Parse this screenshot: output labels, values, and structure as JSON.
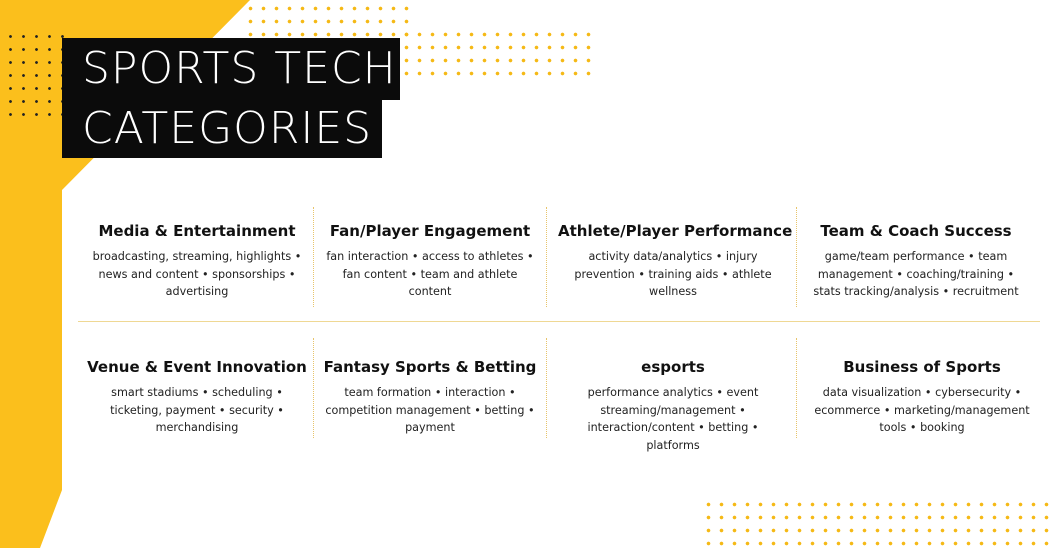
{
  "title": {
    "line1": "SPORTS TECH",
    "line2": "CATEGORIES"
  },
  "colors": {
    "accent": "#fbbf1c",
    "title_bg": "#0b0b0b",
    "divider": "#efd894"
  },
  "categories": [
    {
      "name": "Media & Entertainment",
      "text": "broadcasting, streaming, highlights • news and content • sponsorships • advertising"
    },
    {
      "name": "Fan/Player Engagement",
      "text": "fan interaction • access to athletes • fan content • team and athlete content"
    },
    {
      "name": "Athlete/Player Performance",
      "text": "activity data/analytics • injury prevention • training aids • athlete wellness"
    },
    {
      "name": "Team & Coach Success",
      "text": "game/team performance • team management • coaching/training • stats tracking/analysis • recruitment"
    },
    {
      "name": "Venue & Event Innovation",
      "text": "smart stadiums • scheduling • ticketing, payment • security • merchandising"
    },
    {
      "name": "Fantasy Sports & Betting",
      "text": "team formation • interaction • competition management • betting • payment"
    },
    {
      "name": "esports",
      "text": "performance analytics • event streaming/management • interaction/content • betting • platforms"
    },
    {
      "name": "Business of Sports",
      "text": "data visualization • cybersecurity • ecommerce • marketing/management tools • booking"
    }
  ]
}
